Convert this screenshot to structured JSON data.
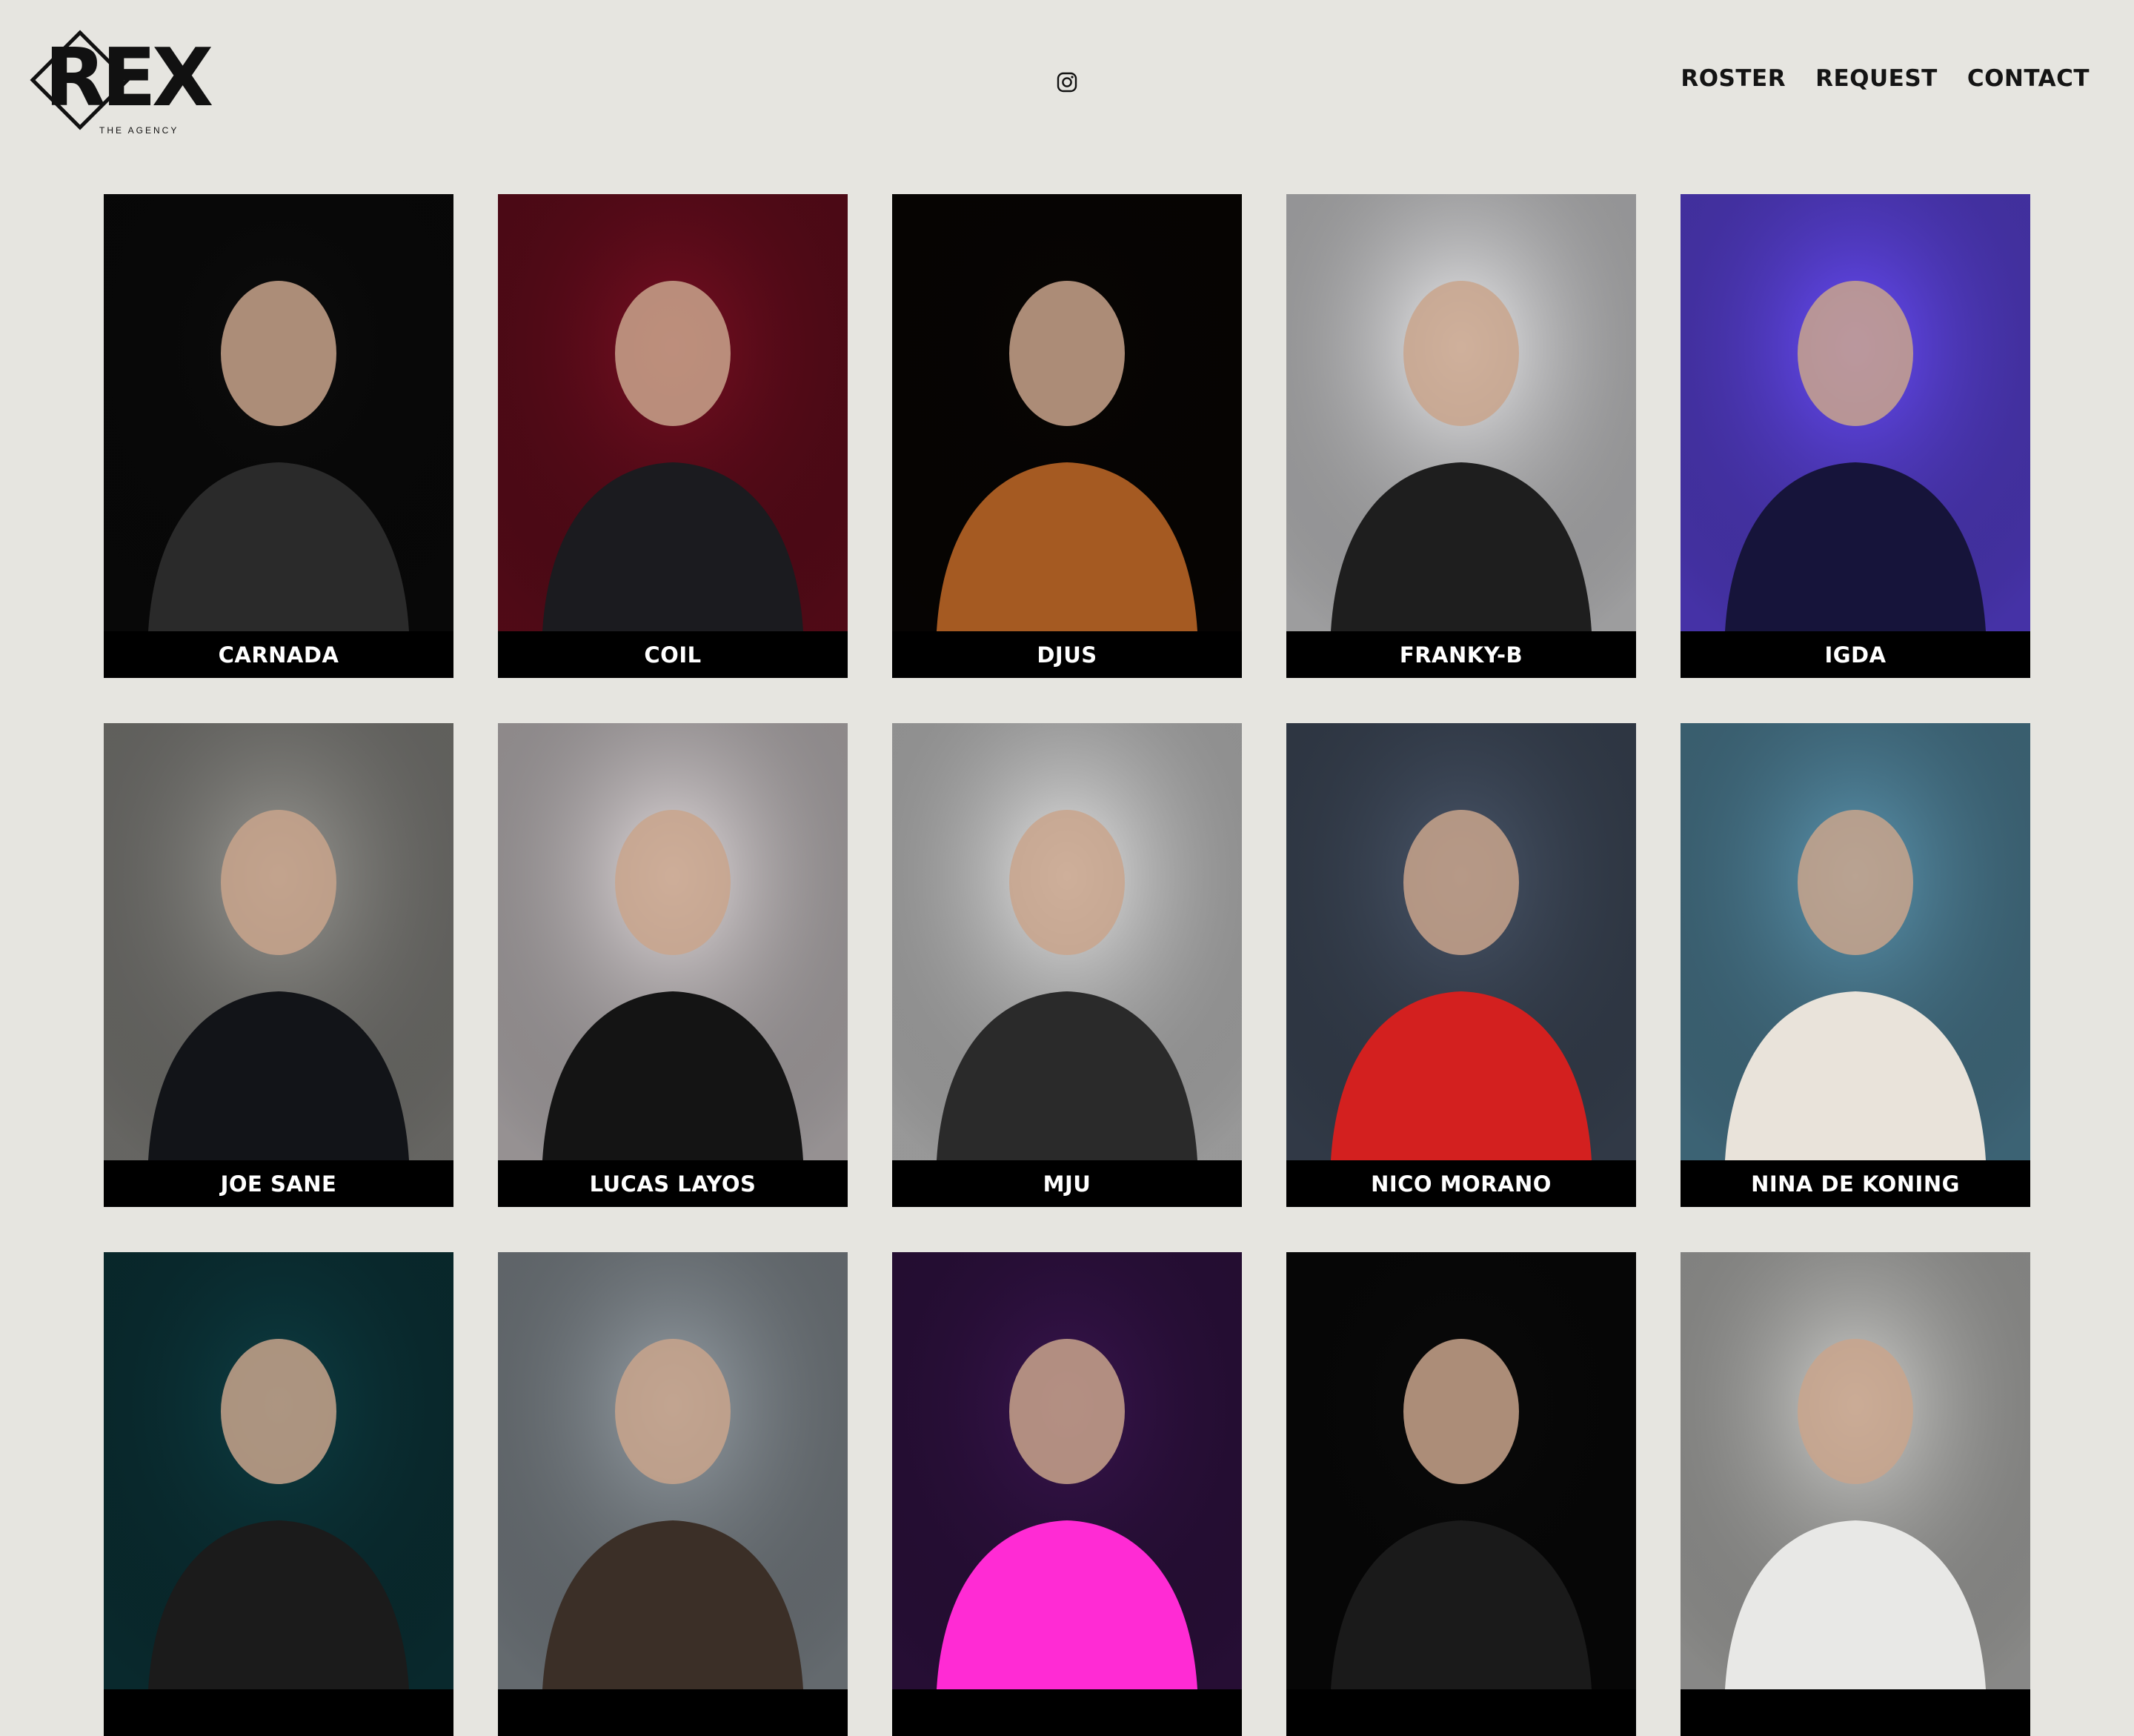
{
  "brand": {
    "logo_text": "REX",
    "logo_subtitle": "THE AGENCY"
  },
  "header": {
    "social_icon": "instagram-icon"
  },
  "nav": {
    "items": [
      "ROSTER",
      "REQUEST",
      "CONTACT"
    ]
  },
  "roster": [
    {
      "name": "CARNADA",
      "bg": "#0c0c0c",
      "accent": "#2a2a2a"
    },
    {
      "name": "COIL",
      "bg": "#7a0f22",
      "accent": "#1b1b1f"
    },
    {
      "name": "DJUS",
      "bg": "#090604",
      "accent": "#a55a22"
    },
    {
      "name": "FRANKY-B",
      "bg": "#f1f1f3",
      "accent": "#1e1e1e"
    },
    {
      "name": "IGDA",
      "bg": "#6a4dff",
      "accent": "#16143a"
    },
    {
      "name": "JOE SANE",
      "bg": "#9c9b96",
      "accent": "#121418"
    },
    {
      "name": "LUCAS LAYOS",
      "bg": "#e6dfe1",
      "accent": "#141414"
    },
    {
      "name": "MJU",
      "bg": "#e9e9e9",
      "accent": "#2a2a2a"
    },
    {
      "name": "NICO MORANO",
      "bg": "#4b586c",
      "accent": "#d3201f"
    },
    {
      "name": "NINA DE KONING",
      "bg": "#5d98b3",
      "accent": "#e9e3da"
    },
    {
      "name": "",
      "bg": "#0e3f45",
      "accent": "#1b1b1b"
    },
    {
      "name": "",
      "bg": "#9aa3aa",
      "accent": "#3b2f27"
    },
    {
      "name": "",
      "bg": "#3a1550",
      "accent": "#ff2bd4"
    },
    {
      "name": "",
      "bg": "#0a0a0a",
      "accent": "#1a1a1a"
    },
    {
      "name": "",
      "bg": "#d2d2cf",
      "accent": "#e8e8e6"
    }
  ]
}
